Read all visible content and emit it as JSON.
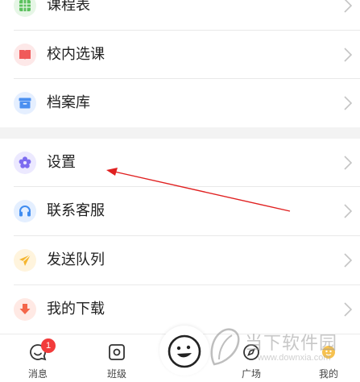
{
  "menu_groups": [
    {
      "items": [
        {
          "label": "课程表",
          "icon": "calendar-grid-icon",
          "color": "#5ac05c",
          "bg": "#e6f6e6"
        },
        {
          "label": "校内选课",
          "icon": "open-book-icon",
          "color": "#f05a5a",
          "bg": "#fde8e8"
        },
        {
          "label": "档案库",
          "icon": "archive-box-icon",
          "color": "#4a8ff0",
          "bg": "#e5efff"
        }
      ]
    },
    {
      "items": [
        {
          "label": "设置",
          "icon": "flower-gear-icon",
          "color": "#7d6cf0",
          "bg": "#ece9ff"
        },
        {
          "label": "联系客服",
          "icon": "headset-icon",
          "color": "#3f8cf0",
          "bg": "#e4efff"
        },
        {
          "label": "发送队列",
          "icon": "paper-plane-icon",
          "color": "#f5b630",
          "bg": "#fff4dd"
        },
        {
          "label": "我的下载",
          "icon": "download-icon",
          "color": "#f4664a",
          "bg": "#ffe9e4"
        }
      ]
    }
  ],
  "tabbar": {
    "tabs": [
      {
        "label": "消息",
        "icon": "message-face-icon",
        "badge": "1"
      },
      {
        "label": "班级",
        "icon": "class-square-icon"
      },
      {
        "label": "",
        "icon": "smiley-center-icon"
      },
      {
        "label": "广场",
        "icon": "compass-icon"
      },
      {
        "label": "我的",
        "icon": "profile-icon"
      }
    ]
  },
  "watermark": {
    "title": "当下软件园",
    "url": "www.downxia.com"
  },
  "colors": {
    "annotation_arrow": "#e02020",
    "text": "#222222",
    "divider": "#e9e9e9",
    "section_gap": "#f3f3f3"
  }
}
